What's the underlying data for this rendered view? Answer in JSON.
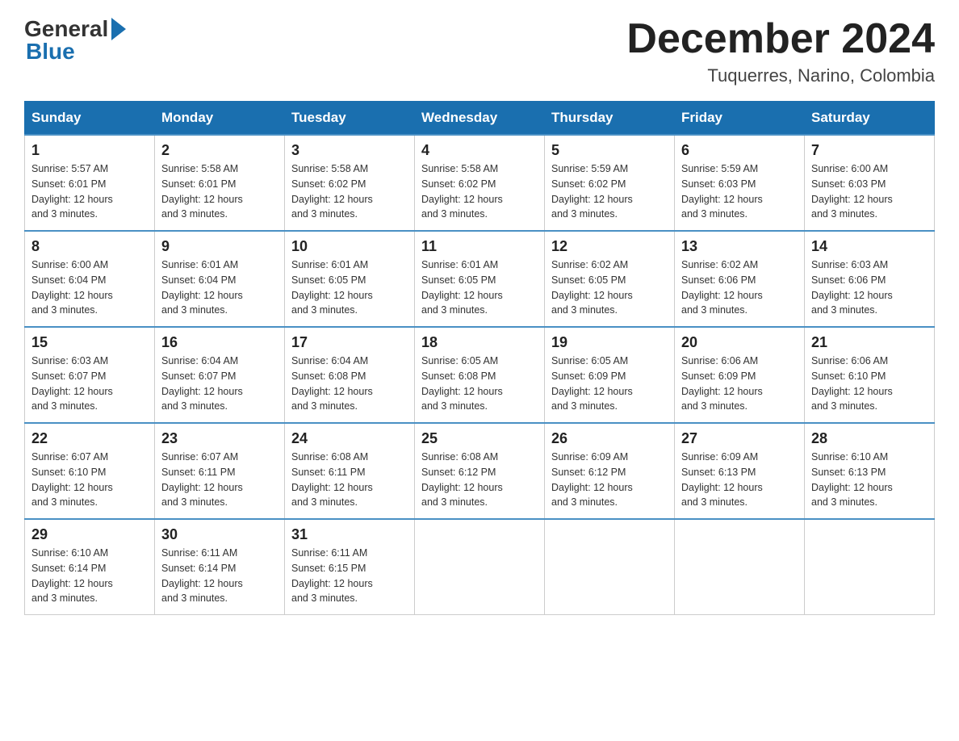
{
  "header": {
    "logo_text_general": "General",
    "logo_text_blue": "Blue",
    "month_title": "December 2024",
    "location": "Tuquerres, Narino, Colombia"
  },
  "days_of_week": [
    "Sunday",
    "Monday",
    "Tuesday",
    "Wednesday",
    "Thursday",
    "Friday",
    "Saturday"
  ],
  "weeks": [
    [
      {
        "day": "1",
        "sunrise": "5:57 AM",
        "sunset": "6:01 PM",
        "daylight": "12 hours and 3 minutes."
      },
      {
        "day": "2",
        "sunrise": "5:58 AM",
        "sunset": "6:01 PM",
        "daylight": "12 hours and 3 minutes."
      },
      {
        "day": "3",
        "sunrise": "5:58 AM",
        "sunset": "6:02 PM",
        "daylight": "12 hours and 3 minutes."
      },
      {
        "day": "4",
        "sunrise": "5:58 AM",
        "sunset": "6:02 PM",
        "daylight": "12 hours and 3 minutes."
      },
      {
        "day": "5",
        "sunrise": "5:59 AM",
        "sunset": "6:02 PM",
        "daylight": "12 hours and 3 minutes."
      },
      {
        "day": "6",
        "sunrise": "5:59 AM",
        "sunset": "6:03 PM",
        "daylight": "12 hours and 3 minutes."
      },
      {
        "day": "7",
        "sunrise": "6:00 AM",
        "sunset": "6:03 PM",
        "daylight": "12 hours and 3 minutes."
      }
    ],
    [
      {
        "day": "8",
        "sunrise": "6:00 AM",
        "sunset": "6:04 PM",
        "daylight": "12 hours and 3 minutes."
      },
      {
        "day": "9",
        "sunrise": "6:01 AM",
        "sunset": "6:04 PM",
        "daylight": "12 hours and 3 minutes."
      },
      {
        "day": "10",
        "sunrise": "6:01 AM",
        "sunset": "6:05 PM",
        "daylight": "12 hours and 3 minutes."
      },
      {
        "day": "11",
        "sunrise": "6:01 AM",
        "sunset": "6:05 PM",
        "daylight": "12 hours and 3 minutes."
      },
      {
        "day": "12",
        "sunrise": "6:02 AM",
        "sunset": "6:05 PM",
        "daylight": "12 hours and 3 minutes."
      },
      {
        "day": "13",
        "sunrise": "6:02 AM",
        "sunset": "6:06 PM",
        "daylight": "12 hours and 3 minutes."
      },
      {
        "day": "14",
        "sunrise": "6:03 AM",
        "sunset": "6:06 PM",
        "daylight": "12 hours and 3 minutes."
      }
    ],
    [
      {
        "day": "15",
        "sunrise": "6:03 AM",
        "sunset": "6:07 PM",
        "daylight": "12 hours and 3 minutes."
      },
      {
        "day": "16",
        "sunrise": "6:04 AM",
        "sunset": "6:07 PM",
        "daylight": "12 hours and 3 minutes."
      },
      {
        "day": "17",
        "sunrise": "6:04 AM",
        "sunset": "6:08 PM",
        "daylight": "12 hours and 3 minutes."
      },
      {
        "day": "18",
        "sunrise": "6:05 AM",
        "sunset": "6:08 PM",
        "daylight": "12 hours and 3 minutes."
      },
      {
        "day": "19",
        "sunrise": "6:05 AM",
        "sunset": "6:09 PM",
        "daylight": "12 hours and 3 minutes."
      },
      {
        "day": "20",
        "sunrise": "6:06 AM",
        "sunset": "6:09 PM",
        "daylight": "12 hours and 3 minutes."
      },
      {
        "day": "21",
        "sunrise": "6:06 AM",
        "sunset": "6:10 PM",
        "daylight": "12 hours and 3 minutes."
      }
    ],
    [
      {
        "day": "22",
        "sunrise": "6:07 AM",
        "sunset": "6:10 PM",
        "daylight": "12 hours and 3 minutes."
      },
      {
        "day": "23",
        "sunrise": "6:07 AM",
        "sunset": "6:11 PM",
        "daylight": "12 hours and 3 minutes."
      },
      {
        "day": "24",
        "sunrise": "6:08 AM",
        "sunset": "6:11 PM",
        "daylight": "12 hours and 3 minutes."
      },
      {
        "day": "25",
        "sunrise": "6:08 AM",
        "sunset": "6:12 PM",
        "daylight": "12 hours and 3 minutes."
      },
      {
        "day": "26",
        "sunrise": "6:09 AM",
        "sunset": "6:12 PM",
        "daylight": "12 hours and 3 minutes."
      },
      {
        "day": "27",
        "sunrise": "6:09 AM",
        "sunset": "6:13 PM",
        "daylight": "12 hours and 3 minutes."
      },
      {
        "day": "28",
        "sunrise": "6:10 AM",
        "sunset": "6:13 PM",
        "daylight": "12 hours and 3 minutes."
      }
    ],
    [
      {
        "day": "29",
        "sunrise": "6:10 AM",
        "sunset": "6:14 PM",
        "daylight": "12 hours and 3 minutes."
      },
      {
        "day": "30",
        "sunrise": "6:11 AM",
        "sunset": "6:14 PM",
        "daylight": "12 hours and 3 minutes."
      },
      {
        "day": "31",
        "sunrise": "6:11 AM",
        "sunset": "6:15 PM",
        "daylight": "12 hours and 3 minutes."
      },
      null,
      null,
      null,
      null
    ]
  ],
  "labels": {
    "sunrise": "Sunrise:",
    "sunset": "Sunset:",
    "daylight": "Daylight:"
  }
}
